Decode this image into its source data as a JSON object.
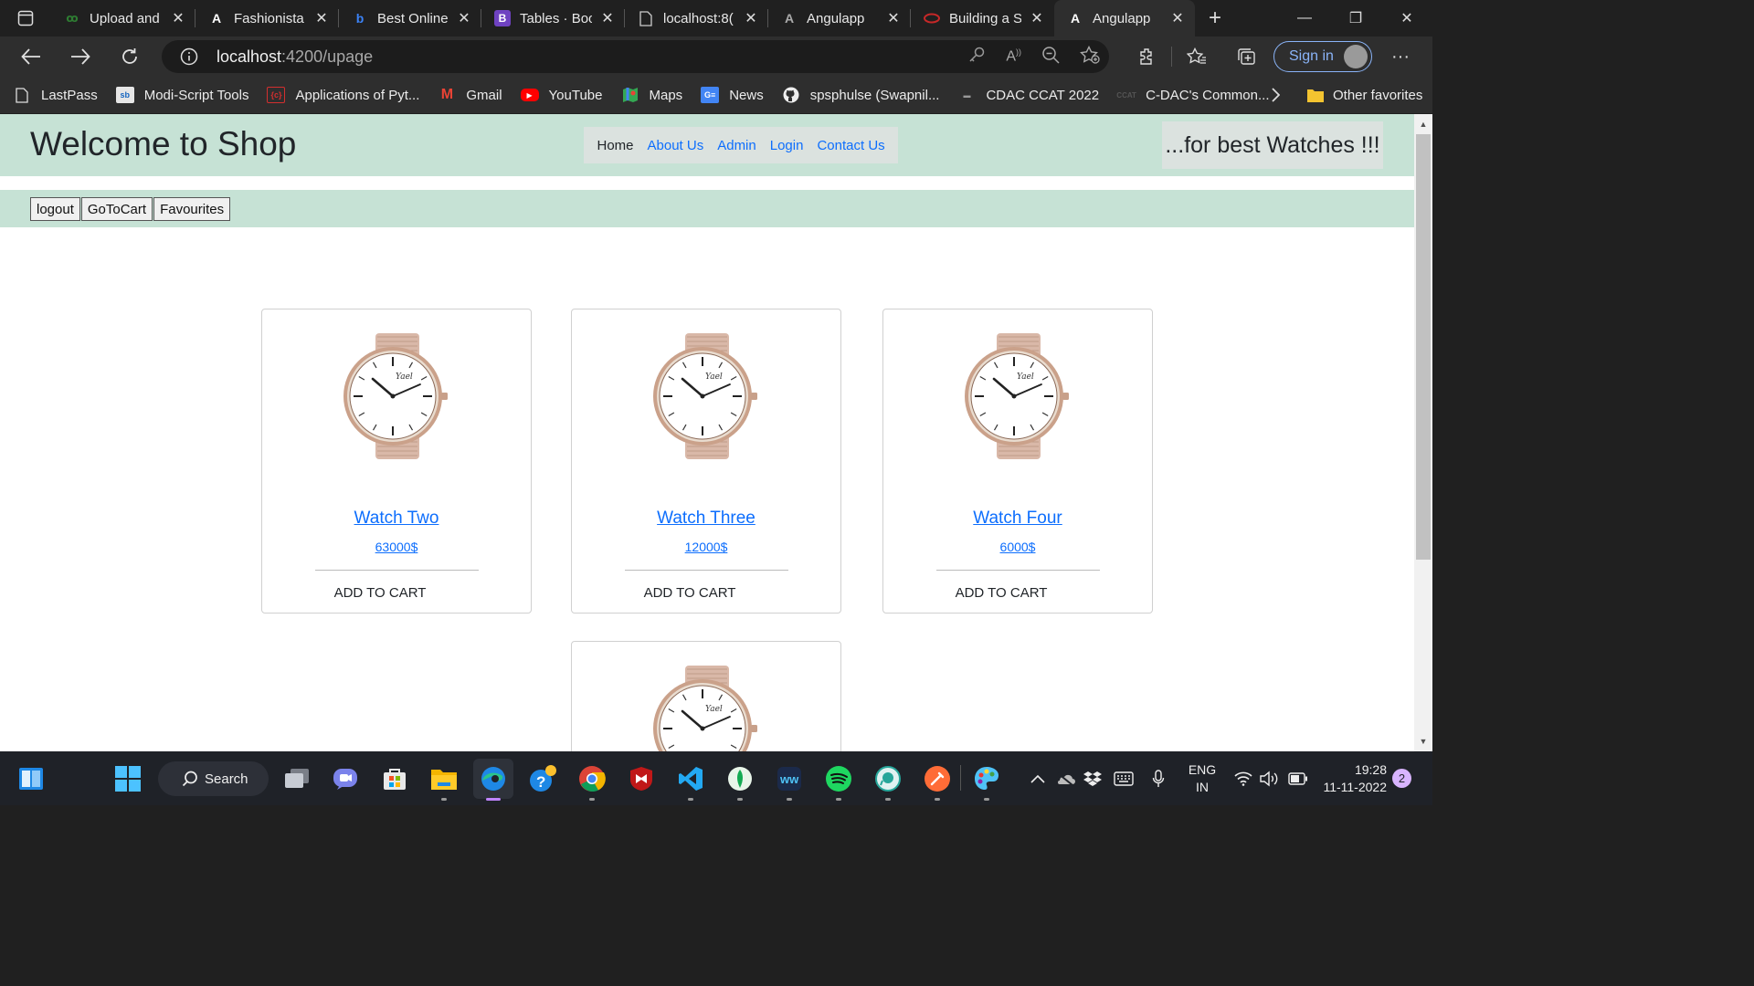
{
  "browser": {
    "tabs": [
      {
        "title": "Upload and",
        "icon": "green-dots-favicon-icon"
      },
      {
        "title": "Fashionista",
        "icon": "angular-favicon-icon"
      },
      {
        "title": "Best Online",
        "icon": "bing-favicon-icon"
      },
      {
        "title": "Tables · Boo",
        "icon": "bootstrap-favicon-icon"
      },
      {
        "title": "localhost:8(",
        "icon": "page-favicon-icon"
      },
      {
        "title": "Angulapp",
        "icon": "angular-favicon-icon"
      },
      {
        "title": "Building a S",
        "icon": "red-favicon-icon"
      },
      {
        "title": "Angulapp",
        "icon": "angular-favicon-icon",
        "active": true
      }
    ],
    "url_host": "localhost",
    "url_path": ":4200/upage",
    "signin_label": "Sign in",
    "bookmarks": [
      {
        "label": "LastPass",
        "icon": "page-icon"
      },
      {
        "label": "Modi-Script Tools",
        "icon": "modi-icon"
      },
      {
        "label": "Applications of Pyt...",
        "icon": "code-icon"
      },
      {
        "label": "Gmail",
        "icon": "gmail-icon"
      },
      {
        "label": "YouTube",
        "icon": "youtube-icon"
      },
      {
        "label": "Maps",
        "icon": "maps-icon"
      },
      {
        "label": "News",
        "icon": "news-icon"
      },
      {
        "label": "spsphulse (Swapnil...",
        "icon": "github-icon"
      },
      {
        "label": "CDAC CCAT 2022",
        "icon": "cdac-icon"
      },
      {
        "label": "C-DAC's Common...",
        "icon": "ccat-icon"
      }
    ],
    "other_favorites": "Other favorites"
  },
  "page": {
    "title": "Welcome to Shop",
    "nav": {
      "home": "Home",
      "about": "About Us",
      "admin": "Admin",
      "login": "Login",
      "contact": "Contact Us"
    },
    "tagline": "...for best Watches !!!",
    "actions": {
      "logout": "logout",
      "cart": "GoToCart",
      "favourites": "Favourites"
    },
    "products": [
      {
        "name": "Watch Two",
        "price": "63000$",
        "cta": "ADD TO CART"
      },
      {
        "name": "Watch Three",
        "price": "12000$",
        "cta": "ADD TO CART"
      },
      {
        "name": "Watch Four",
        "price": "6000$",
        "cta": "ADD TO CART"
      },
      {
        "name": "",
        "price": "",
        "cta": ""
      }
    ]
  },
  "taskbar": {
    "search_label": "Search",
    "lang_line1": "ENG",
    "lang_line2": "IN",
    "time": "19:28",
    "date": "11-11-2022",
    "notification_count": "2"
  }
}
